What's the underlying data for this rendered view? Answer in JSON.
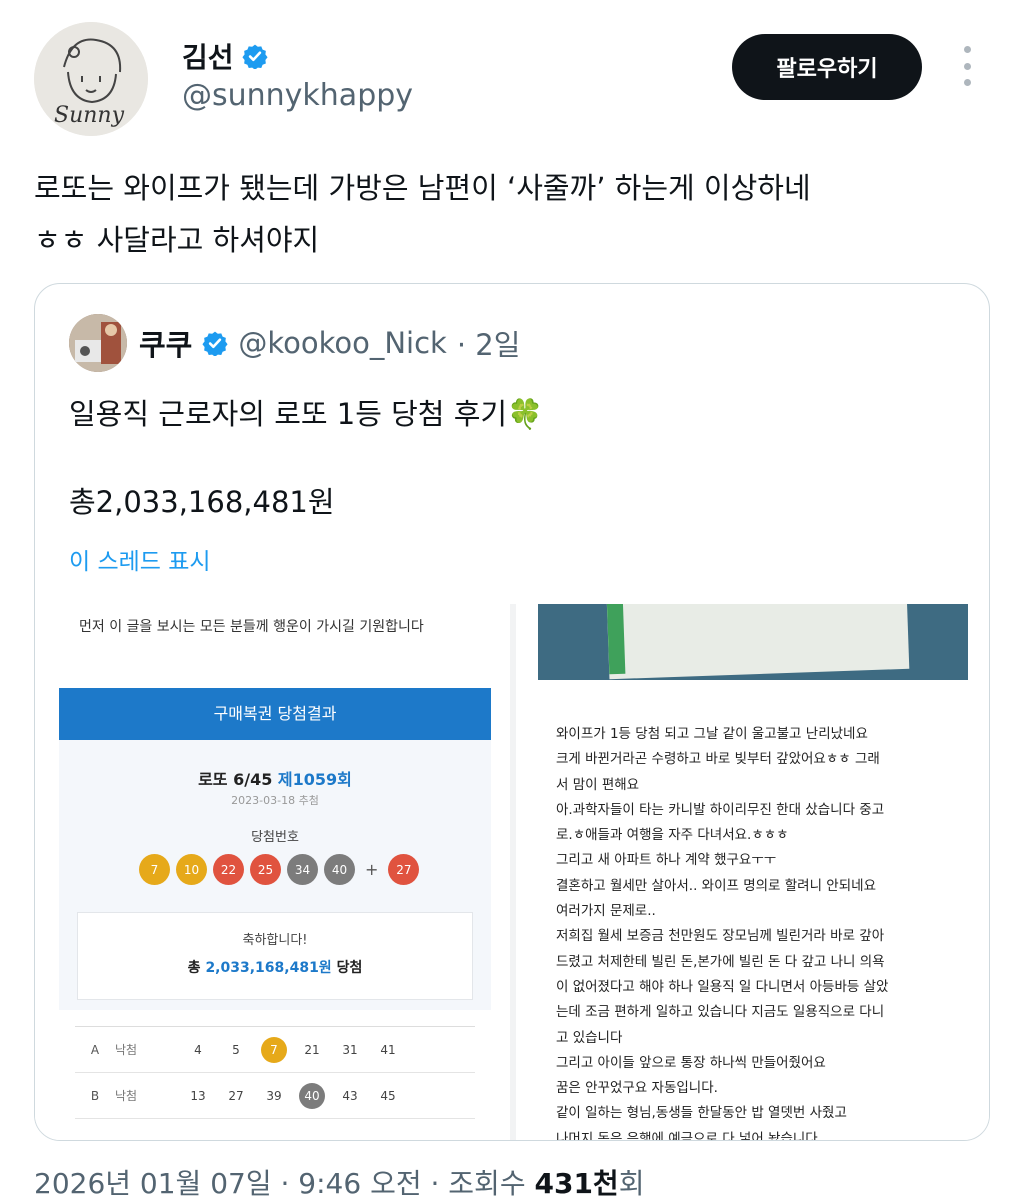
{
  "author": {
    "name": "김선",
    "handle": "@sunnykhappy",
    "avatar_text": "Sunny"
  },
  "follow_label": "팔로우하기",
  "tweet": {
    "line1": "로또는 와이프가 됐는데 가방은 남편이 ‘사줄까’ 하는게 이상하네",
    "line2": "ㅎㅎ 사달라고 하셔야지"
  },
  "quote": {
    "name": "쿠쿠",
    "handle": "@kookoo_Nick",
    "time": "· 2일",
    "text_line1": "일용직 근로자의 로또 1등 당첨 후기",
    "clover": "🍀",
    "text_line2": "총2,033,168,481원",
    "show_thread": "이 스레드 표시"
  },
  "image_left": {
    "intro": "먼저 이 글을 보시는 모든 분들께 행운이 가시길 기원합니다",
    "box_title": "구매복권 당첨결과",
    "round_label": "로또 6/45",
    "round_number": "제1059회",
    "draw_date": "2023-03-18 추첨",
    "winning_label": "당첨번호",
    "balls": [
      {
        "n": "7",
        "color": "#e6a91a"
      },
      {
        "n": "10",
        "color": "#e6a91a"
      },
      {
        "n": "22",
        "color": "#e0533f"
      },
      {
        "n": "25",
        "color": "#e0533f"
      },
      {
        "n": "34",
        "color": "#7c7c7c"
      },
      {
        "n": "40",
        "color": "#7c7c7c"
      }
    ],
    "bonus_ball": {
      "n": "27",
      "color": "#e0533f"
    },
    "congrats": "축하합니다!",
    "prize_prefix": "총",
    "prize_amount": "2,033,168,481원",
    "prize_suffix": "당첨",
    "rows": [
      {
        "line": "A",
        "result": "낙첨",
        "nums": [
          "4",
          "5",
          "7",
          "21",
          "31",
          "41"
        ],
        "hit": 2,
        "hit_color": "#e6a91a"
      },
      {
        "line": "B",
        "result": "낙첨",
        "nums": [
          "13",
          "27",
          "39",
          "40",
          "43",
          "45"
        ],
        "hit": 3,
        "hit_color": "#7c7c7c"
      }
    ]
  },
  "image_right": {
    "lines": [
      "와이프가 1등 당첨 되고 그날 같이 울고불고 난리났네요",
      "크게 바뀐거라곤 수령하고 바로 빚부터 갚았어요ㅎㅎ 그래",
      "서 맘이 편해요",
      "아.과학자들이 타는 카니발 하이리무진 한대 샀습니다 중고",
      "로.ㅎ애들과 여행을 자주 다녀서요.ㅎㅎㅎ",
      "그리고 새 아파트 하나 계약 했구요ㅜㅜ",
      "결혼하고 월세만 살아서.. 와이프 명의로 할려니 안되네요",
      "여러가지 문제로..",
      "저희집 월세 보증금 천만원도 장모님께 빌린거라 바로 갚아",
      "드렸고 처제한테 빌린 돈,본가에 빌린 돈 다 갚고 나니 의욕",
      "이 없어졌다고 해야 하나 일용직 일 다니면서 아등바등 살았",
      "는데 조금 편하게 일하고 있습니다 지금도 일용직으로 다니",
      "고 있습니다",
      "그리고 아이들 앞으로 통장 하나씩 만들어줬어요",
      "꿈은 안꾸었구요 자동입니다.",
      "같이 일하는 형님,동생들 한달동안 밥 열뎃번 사줬고",
      "나머지 돈은 은행에 예금으로 다 넣어 놨습니다"
    ]
  },
  "timestamp": {
    "date": "2026년 01월 07일 · 9:46 오전 · 조회수 ",
    "views": "431천",
    "views_suffix": "회"
  }
}
